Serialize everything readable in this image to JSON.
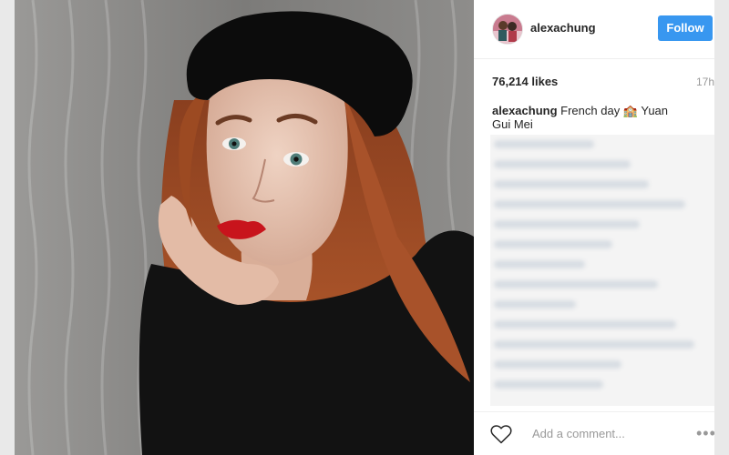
{
  "post": {
    "username": "alexachung",
    "follow_label": "Follow",
    "likes": "76,214 likes",
    "time": "17h",
    "caption_user": "alexachung",
    "caption_text": "French day 🏫 Yuan Gui Mei",
    "comment_placeholder": "Add a comment...",
    "more_label": "•••"
  },
  "colors": {
    "follow_button": "#3897f0",
    "text": "#262626",
    "muted": "#999999"
  },
  "icons": {
    "like": "heart-icon",
    "more": "more-options-icon"
  }
}
